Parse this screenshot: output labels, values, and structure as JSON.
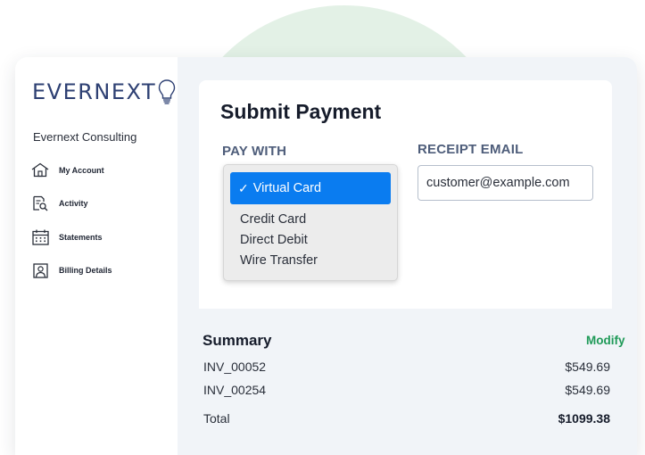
{
  "brand": {
    "logo_text": "EVERNEXT",
    "company_name": "Evernext Consulting",
    "accent": "#2e4073"
  },
  "sidebar": {
    "items": [
      {
        "label": "My Account",
        "icon": "home-icon"
      },
      {
        "label": "Activity",
        "icon": "document-search-icon"
      },
      {
        "label": "Statements",
        "icon": "calendar-icon"
      },
      {
        "label": "Billing Details",
        "icon": "user-card-icon"
      }
    ]
  },
  "payment": {
    "title": "Submit Payment",
    "pay_with_label": "PAY WITH",
    "receipt_email_label": "RECEIPT EMAIL",
    "receipt_email_value": "customer@example.com",
    "selected_method": "Virtual Card",
    "other_methods": [
      "Credit Card",
      "Direct Debit",
      "Wire Transfer"
    ],
    "selected_color": "#0a7cf0"
  },
  "summary": {
    "title": "Summary",
    "modify_label": "Modify",
    "modify_color": "#1f9a58",
    "rows": [
      {
        "label": "INV_00052",
        "amount": "$549.69"
      },
      {
        "label": "INV_00254",
        "amount": "$549.69"
      }
    ],
    "total_label": "Total",
    "total_amount": "$1099.38"
  }
}
